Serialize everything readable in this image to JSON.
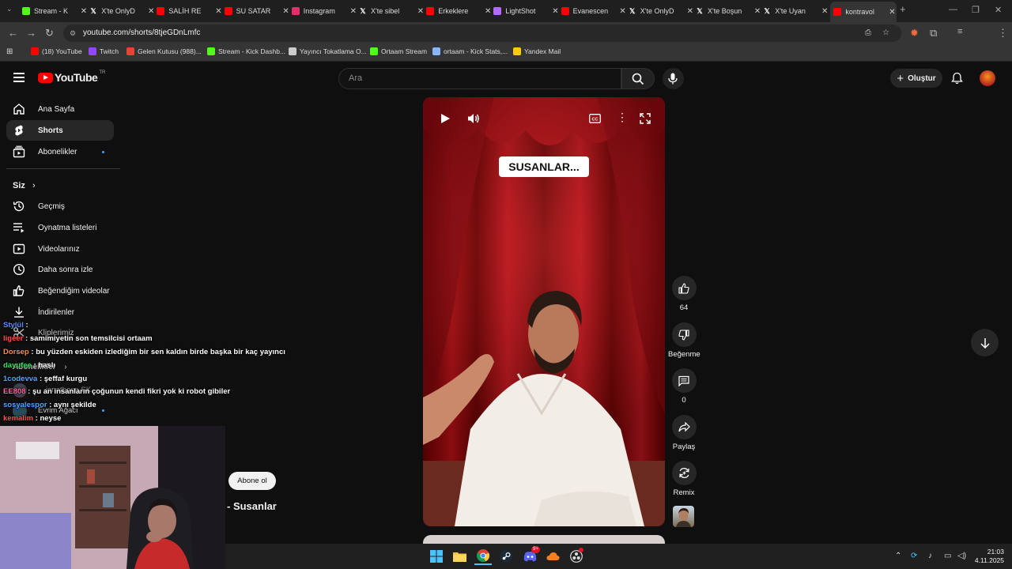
{
  "browser": {
    "tabs": [
      {
        "label": "Stream - K",
        "icon": "kick-icon",
        "color": "#53fc18"
      },
      {
        "label": "X'te OnlyD",
        "icon": "x-icon",
        "color": "#ffffff"
      },
      {
        "label": "SALİH RE",
        "icon": "youtube-icon",
        "color": "#ff0000"
      },
      {
        "label": "SU SATAR",
        "icon": "youtube-icon",
        "color": "#ff0000"
      },
      {
        "label": "Instagram",
        "icon": "instagram-icon",
        "color": "#e1306c"
      },
      {
        "label": "X'te sibel",
        "icon": "x-icon",
        "color": "#ffffff"
      },
      {
        "label": "Erkeklere",
        "icon": "youtube-icon",
        "color": "#ff0000"
      },
      {
        "label": "LightShot",
        "icon": "lightshot-icon",
        "color": "#b36bff"
      },
      {
        "label": "Evanescen",
        "icon": "youtube-icon",
        "color": "#ff0000"
      },
      {
        "label": "X'te OnlyD",
        "icon": "x-icon",
        "color": "#ffffff"
      },
      {
        "label": "X'te Boşun",
        "icon": "x-icon",
        "color": "#ffffff"
      },
      {
        "label": "X'te Uyan",
        "icon": "x-icon",
        "color": "#ffffff"
      },
      {
        "label": "kontravol",
        "icon": "youtube-icon",
        "color": "#ff0000"
      }
    ],
    "url": "youtube.com/shorts/8tjeGDnLmfc",
    "profile_letter": "C",
    "bookmarks": [
      {
        "label": "(18) YouTube",
        "color": "#ff0000"
      },
      {
        "label": "Twitch",
        "color": "#9146ff"
      },
      {
        "label": "Gelen Kutusu (988)...",
        "color": "#ea4335"
      },
      {
        "label": "Stream - Kick Dashb...",
        "color": "#53fc18"
      },
      {
        "label": "Yayıncı Tokatlama O...",
        "color": "#cccccc"
      },
      {
        "label": "Ortaam Stream",
        "color": "#53fc18"
      },
      {
        "label": "ortaam - Kick Stats,...",
        "color": "#8ab4f8"
      },
      {
        "label": "Yandex Mail",
        "color": "#ffcc00"
      }
    ]
  },
  "youtube": {
    "logo_text": "YouTube",
    "logo_region": "TR",
    "search_placeholder": "Ara",
    "create_label": "Oluştur",
    "sidebar": {
      "main": [
        {
          "label": "Ana Sayfa",
          "icon": "home-icon"
        },
        {
          "label": "Shorts",
          "icon": "shorts-icon"
        },
        {
          "label": "Abonelikler",
          "icon": "subscriptions-icon"
        }
      ],
      "you_heading": "Siz",
      "you": [
        {
          "label": "Geçmiş",
          "icon": "history-icon"
        },
        {
          "label": "Oynatma listeleri",
          "icon": "playlists-icon"
        },
        {
          "label": "Videolarınız",
          "icon": "your-videos-icon"
        },
        {
          "label": "Daha sonra izle",
          "icon": "watch-later-icon"
        },
        {
          "label": "Beğendiğim videolar",
          "icon": "liked-icon"
        },
        {
          "label": "İndirilenler",
          "icon": "download-icon"
        },
        {
          "label": "Kliplerimiz",
          "icon": "clips-icon"
        }
      ],
      "subs_heading": "Abonelikler",
      "subs": [
        {
          "label": "jonathonn SK"
        },
        {
          "label": "Evrim Ağacı"
        }
      ]
    },
    "short": {
      "caption": "SUSANLAR...",
      "title": "- Susanlar",
      "subscribe_label": "Abone ol",
      "actions": {
        "likes": "64",
        "dislike_label": "Beğenme",
        "comments": "0",
        "share_label": "Paylaş",
        "remix_label": "Remix"
      }
    }
  },
  "chat": [
    {
      "user": "Stylül",
      "text": "",
      "color": "#5b8cff"
    },
    {
      "user": "ligeer",
      "text": "samimiyetin son temsilcisi ortaam",
      "color": "#ff4f4f"
    },
    {
      "user": "Dorsep",
      "text": "bu yüzden eskiden izlediğim bir sen kaldın birde başka bir kaç yayıncı",
      "color": "#ff8a3d"
    },
    {
      "user": "dayufee",
      "text": "haslı",
      "color": "#4bd865"
    },
    {
      "user": "1codevva",
      "text": "şeffaf kurgu",
      "color": "#4da3ff"
    },
    {
      "user": "EE808",
      "text": "şu an insanların çoğunun kendi fikri yok ki robot gibiler",
      "color": "#ff5f9e"
    },
    {
      "user": "sosyalespor",
      "text": "aynı şekilde",
      "color": "#4da3ff"
    },
    {
      "user": "kemalim",
      "text": "neyse",
      "color": "#ff4f4f"
    }
  ],
  "taskbar": {
    "time": "21:03",
    "date": "4.11.2025",
    "discord_badge": "9+"
  }
}
